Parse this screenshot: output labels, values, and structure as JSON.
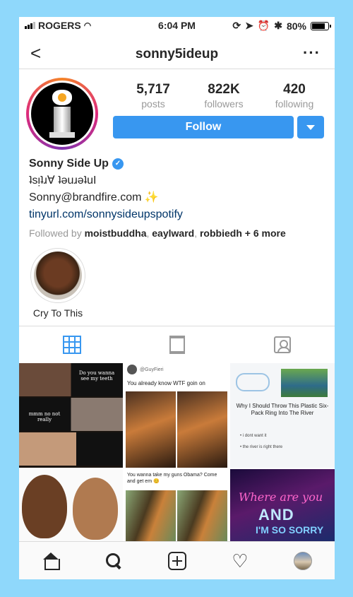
{
  "status_bar": {
    "carrier": "ROGERS",
    "time": "6:04 PM",
    "battery": "80%",
    "battery_level": 0.8
  },
  "nav": {
    "title": "sonny5ideup",
    "back_icon": "chevron-left-icon",
    "more_icon": "more-icon"
  },
  "stats": [
    {
      "value": "5,717",
      "label": "posts"
    },
    {
      "value": "822K",
      "label": "followers"
    },
    {
      "value": "420",
      "label": "following"
    }
  ],
  "follow_label": "Follow",
  "bio": {
    "name": "Sonny Side Up",
    "line1": "ʇsᴉʇɹ∀ ʇǝuɹǝʇuI",
    "email": "Sonny@brandfire.com ✨",
    "link": "tinyurl.com/sonnysideupspotify",
    "followed_prefix": "Followed by",
    "followed_names": "moistbuddha",
    "followed_names2": "eaylward",
    "followed_names3": "robbiedh",
    "followed_more": "+ 6 more"
  },
  "highlight": {
    "label": "Cry To This"
  },
  "posts": {
    "p1_cap1": "Do you wanna see my teeth",
    "p1_cap2": "mmm no not really",
    "p2_text": "You already know WTF goin on",
    "p2_handle": "@GuyFieri",
    "p3_title": "Why I Should Throw This Plastic Six-Pack Ring Into The River",
    "p3_b1": "• i dont want it",
    "p3_b2": "• the river is right there",
    "p5_text": "You wanna take my guns Obama? Come and get em 😊",
    "p6_l1": "Where are you",
    "p6_l2": "AND",
    "p6_l3": "I'M SO SORRY"
  },
  "colors": {
    "accent": "#3897f0",
    "background": "#8fd8fb"
  }
}
